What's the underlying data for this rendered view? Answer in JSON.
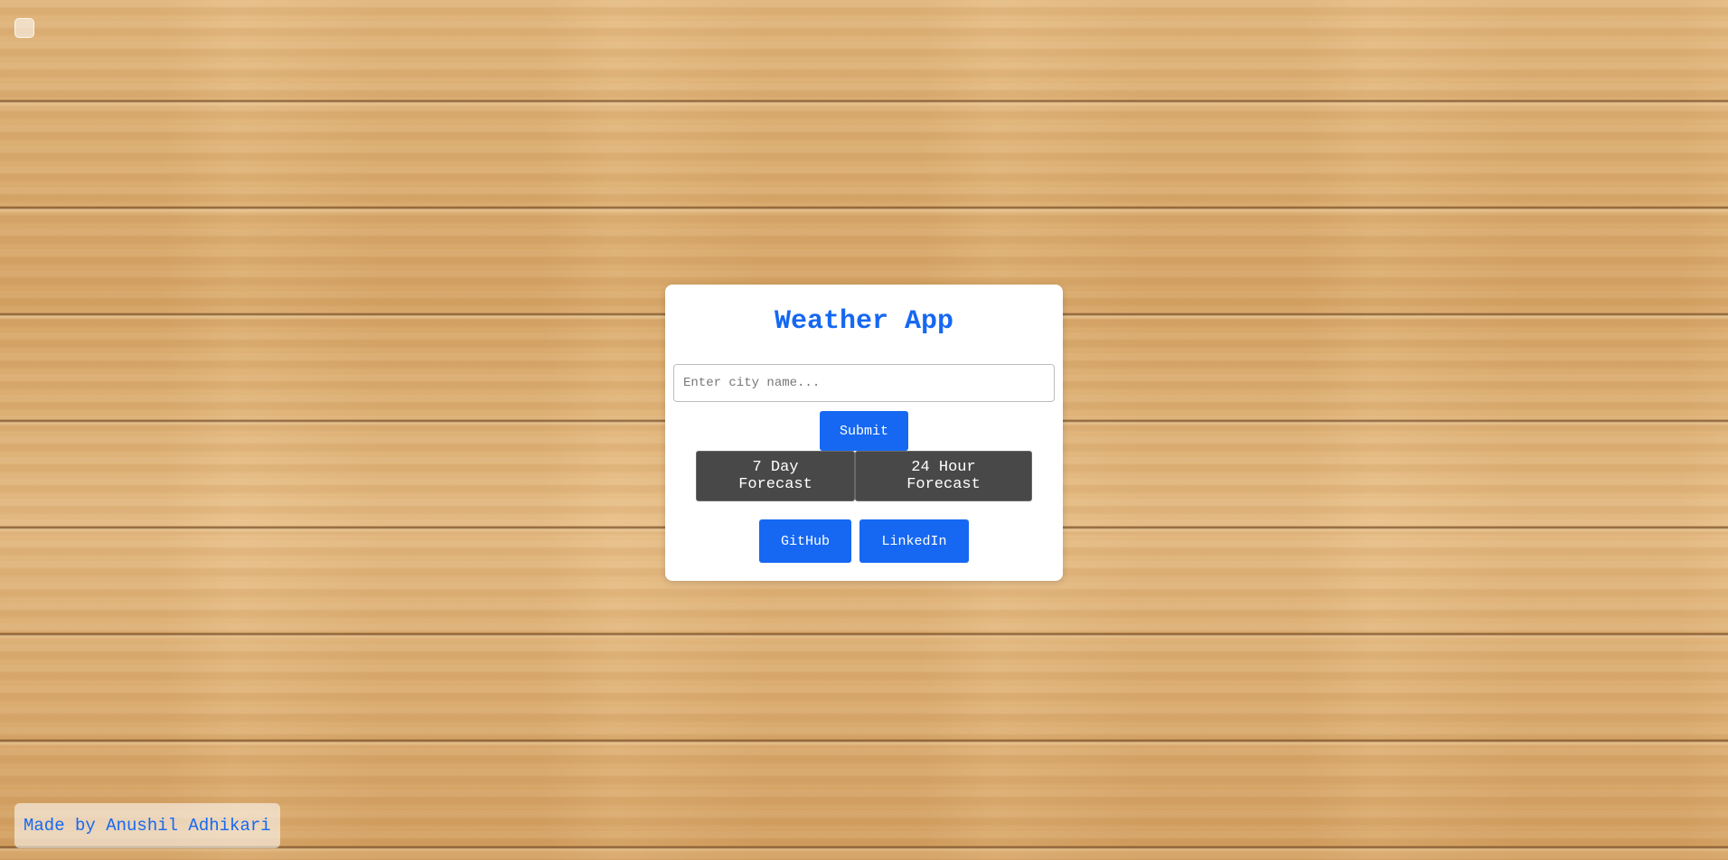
{
  "app": {
    "title": "Weather App"
  },
  "search": {
    "placeholder": "Enter city name...",
    "value": "",
    "submit_label": "Submit"
  },
  "forecast": {
    "seven_day_label": "7 Day Forecast",
    "twenty_four_hour_label": "24 Hour Forecast"
  },
  "links": {
    "github_label": "GitHub",
    "linkedin_label": "LinkedIn"
  },
  "footer": {
    "credit": "Made by Anushil Adhikari"
  },
  "colors": {
    "accent": "#1668f2",
    "dark_button": "#484848",
    "card": "#ffffff"
  }
}
